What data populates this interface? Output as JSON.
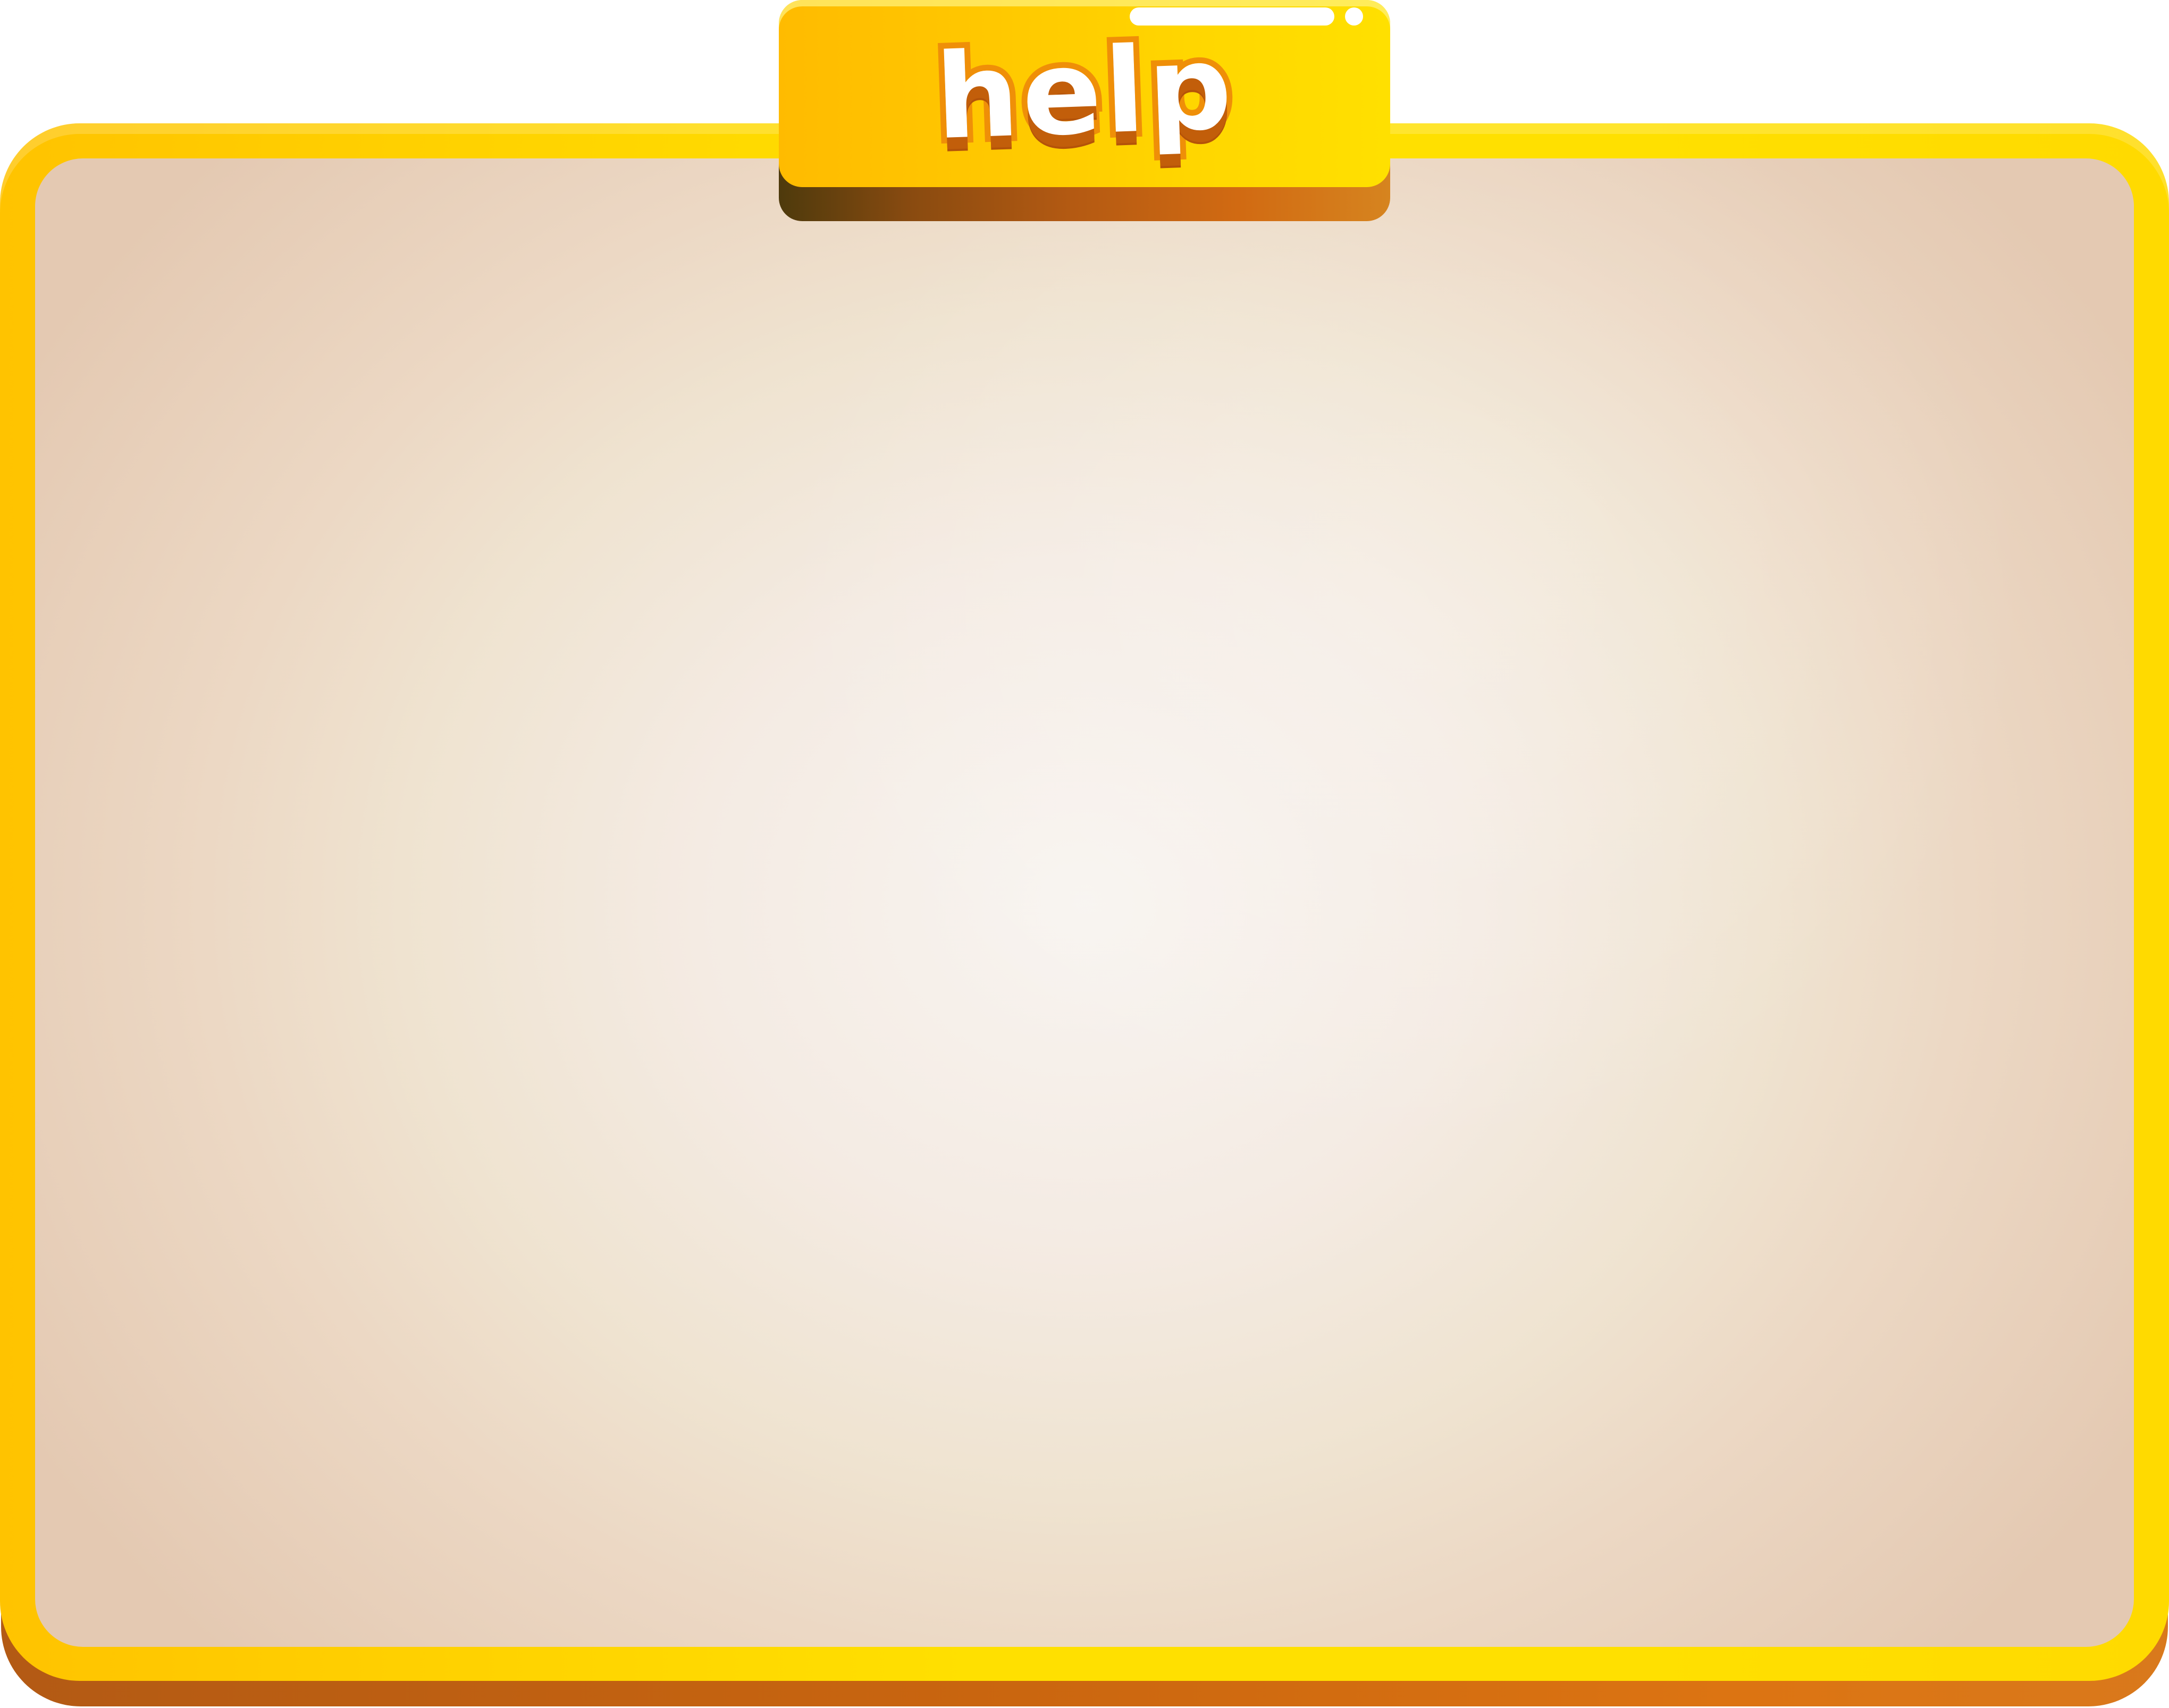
{
  "dialog": {
    "title": "help"
  },
  "colors": {
    "frame_yellow": "#ffe000",
    "frame_orange_edge": "#ffc300",
    "frame_shadow": "#c9650f",
    "panel_background": "#f4ebe3",
    "title_outline": "#ef8f08",
    "title_fill": "#ffffff"
  }
}
